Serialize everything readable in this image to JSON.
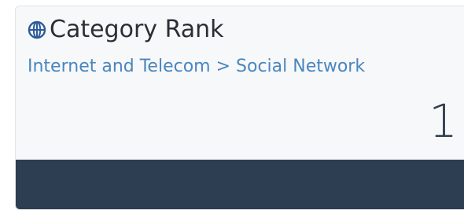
{
  "widget": {
    "title": "Category Rank",
    "category_path": "Internet and Telecom > Social Network",
    "rank": "1",
    "icon": "globe-icon"
  },
  "colors": {
    "title": "#2a2f36",
    "link": "#4a86c0",
    "globe": "#2b5b9a",
    "footer": "#2d3e53"
  }
}
